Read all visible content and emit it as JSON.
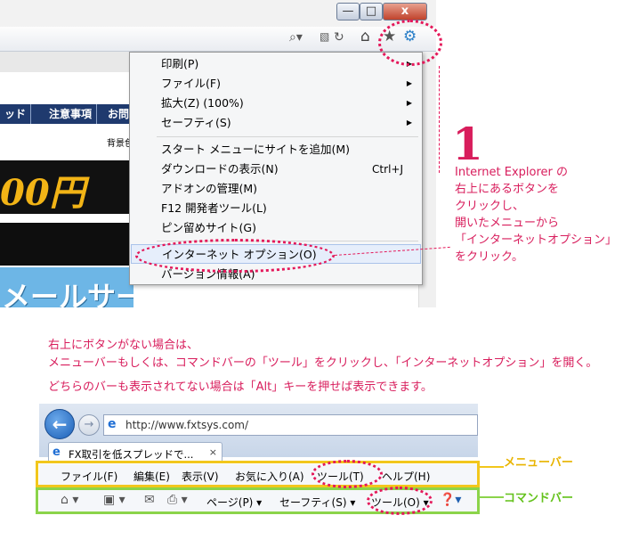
{
  "top_screenshot": {
    "window_controls": {
      "minimize": "—",
      "maximize": "□",
      "close": "x"
    },
    "toolbar_icons": [
      "search-icon",
      "compat-view-icon",
      "refresh-icon",
      "home-icon",
      "favorites-star-icon",
      "gear-icon"
    ],
    "page": {
      "nav_tabs": [
        "ッド",
        "注意事項",
        "お問"
      ],
      "bg_text": "背景色",
      "banner_text": "00円",
      "mail_text": "メールサービス"
    },
    "tools_menu": {
      "items": [
        {
          "label": "印刷(P)",
          "submenu": true
        },
        {
          "label": "ファイル(F)",
          "submenu": true
        },
        {
          "label": "拡大(Z) (100%)",
          "submenu": true
        },
        {
          "label": "セーフティ(S)",
          "submenu": true
        },
        {
          "label": "スタート メニューにサイトを追加(M)"
        },
        {
          "label": "ダウンロードの表示(N)",
          "shortcut": "Ctrl+J"
        },
        {
          "label": "アドオンの管理(M)"
        },
        {
          "label": "F12 開発者ツール(L)"
        },
        {
          "label": "ピン留めサイト(G)"
        },
        {
          "label": "インターネット オプション(O)",
          "highlighted": true
        },
        {
          "label": "バージョン情報(A)"
        }
      ]
    }
  },
  "step": {
    "number": "1",
    "lines": [
      "Internet Explorer の",
      "右上にあるボタンを",
      "クリックし、",
      "開いたメニューから",
      "「インターネットオプション」",
      "をクリック。"
    ]
  },
  "notes": [
    "右上にボタンがない場合は、",
    "メニューバーもしくは、コマンドバーの「ツール」をクリックし、「インターネットオプション」を開く。",
    "どちらのバーも表示されてない場合は「Alt」キーを押せば表示できます。"
  ],
  "bottom_screenshot": {
    "address_url": "http://www.fxtsys.com/",
    "tab_title": "FX取引を低スプレッドで...",
    "tab_close": "×",
    "menubar_items": [
      "ファイル(F)",
      "編集(E)",
      "表示(V)",
      "お気に入り(A)",
      "ツール(T)",
      "ヘルプ(H)"
    ],
    "commandbar_items": [
      "ページ(P) ▾",
      "セーフティ(S) ▾",
      "ツール(O) ▾"
    ]
  },
  "labels": {
    "menubar": "メニューバー",
    "commandbar": "コマンドバー"
  },
  "colors": {
    "annotation_pink": "#d81d5c",
    "menubar_box": "#f2c71c",
    "commandbar_box": "#8bd44a"
  }
}
